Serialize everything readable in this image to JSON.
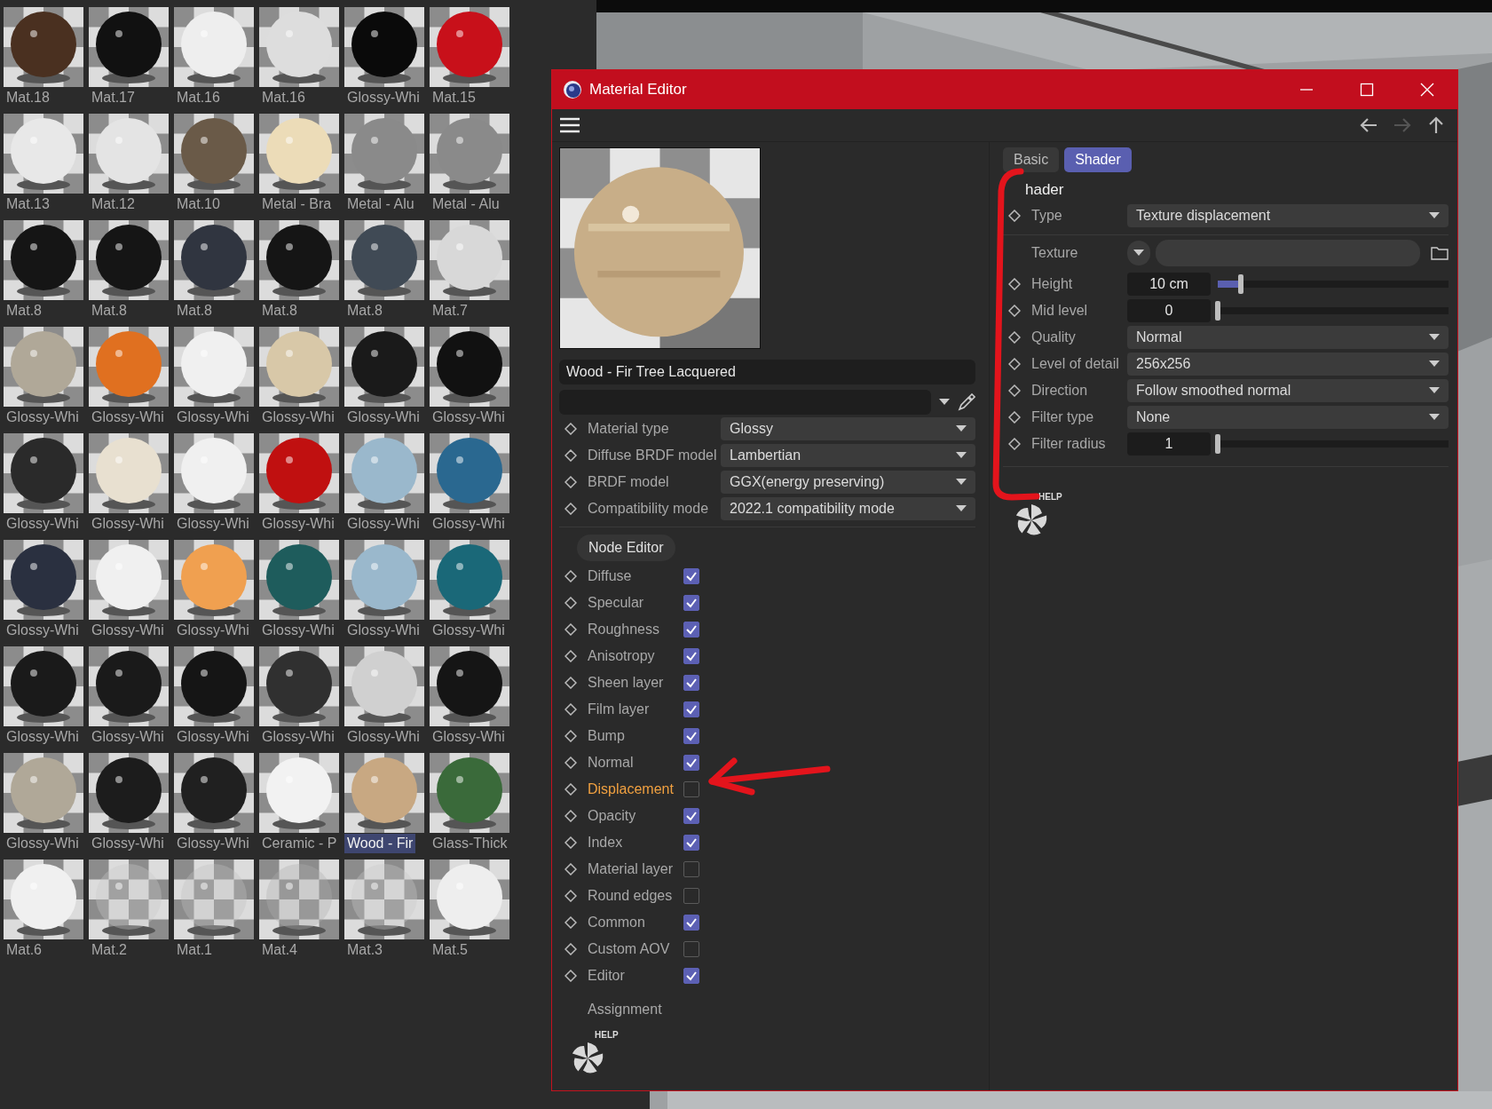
{
  "materials": [
    {
      "name": "Mat.18",
      "selected": false
    },
    {
      "name": "Mat.17",
      "selected": false
    },
    {
      "name": "Mat.16",
      "selected": false
    },
    {
      "name": "Mat.16",
      "selected": false
    },
    {
      "name": "Glossy-Whi",
      "selected": false
    },
    {
      "name": "Mat.15",
      "selected": false
    },
    {
      "name": "Mat.13",
      "selected": false
    },
    {
      "name": "Mat.12",
      "selected": false
    },
    {
      "name": "Mat.10",
      "selected": false
    },
    {
      "name": "Metal - Bra",
      "selected": false
    },
    {
      "name": "Metal - Alu",
      "selected": false
    },
    {
      "name": "Metal - Alu",
      "selected": false
    },
    {
      "name": "Mat.8",
      "selected": false
    },
    {
      "name": "Mat.8",
      "selected": false
    },
    {
      "name": "Mat.8",
      "selected": false
    },
    {
      "name": "Mat.8",
      "selected": false
    },
    {
      "name": "Mat.8",
      "selected": false
    },
    {
      "name": "Mat.7",
      "selected": false
    },
    {
      "name": "Glossy-Whi",
      "selected": false
    },
    {
      "name": "Glossy-Whi",
      "selected": false
    },
    {
      "name": "Glossy-Whi",
      "selected": false
    },
    {
      "name": "Glossy-Whi",
      "selected": false
    },
    {
      "name": "Glossy-Whi",
      "selected": false
    },
    {
      "name": "Glossy-Whi",
      "selected": false
    },
    {
      "name": "Glossy-Whi",
      "selected": false
    },
    {
      "name": "Glossy-Whi",
      "selected": false
    },
    {
      "name": "Glossy-Whi",
      "selected": false
    },
    {
      "name": "Glossy-Whi",
      "selected": false
    },
    {
      "name": "Glossy-Whi",
      "selected": false
    },
    {
      "name": "Glossy-Whi",
      "selected": false
    },
    {
      "name": "Glossy-Whi",
      "selected": false
    },
    {
      "name": "Glossy-Whi",
      "selected": false
    },
    {
      "name": "Glossy-Whi",
      "selected": false
    },
    {
      "name": "Glossy-Whi",
      "selected": false
    },
    {
      "name": "Glossy-Whi",
      "selected": false
    },
    {
      "name": "Glossy-Whi",
      "selected": false
    },
    {
      "name": "Glossy-Whi",
      "selected": false
    },
    {
      "name": "Glossy-Whi",
      "selected": false
    },
    {
      "name": "Glossy-Whi",
      "selected": false
    },
    {
      "name": "Glossy-Whi",
      "selected": false
    },
    {
      "name": "Glossy-Whi",
      "selected": false
    },
    {
      "name": "Glossy-Whi",
      "selected": false
    },
    {
      "name": "Glossy-Whi",
      "selected": false
    },
    {
      "name": "Glossy-Whi",
      "selected": false
    },
    {
      "name": "Glossy-Whi",
      "selected": false
    },
    {
      "name": "Ceramic - P",
      "selected": false
    },
    {
      "name": "Wood - Fir",
      "selected": true
    },
    {
      "name": "Glass-Thick",
      "selected": false
    },
    {
      "name": "Mat.6",
      "selected": false
    },
    {
      "name": "Mat.2",
      "selected": false
    },
    {
      "name": "Mat.1",
      "selected": false
    },
    {
      "name": "Mat.4",
      "selected": false
    },
    {
      "name": "Mat.3",
      "selected": false
    },
    {
      "name": "Mat.5",
      "selected": false
    }
  ],
  "editor": {
    "title": "Material Editor",
    "nav": [
      {
        "kind": "back",
        "disabled": false
      },
      {
        "kind": "forward",
        "disabled": true
      },
      {
        "kind": "up",
        "disabled": false
      }
    ],
    "material_name": "Wood - Fir Tree Lacquered",
    "params": [
      {
        "label": "Material type",
        "value": "Glossy"
      },
      {
        "label": "Diffuse BRDF model",
        "value": "Lambertian"
      },
      {
        "label": "BRDF model",
        "value": "GGX(energy preserving)"
      },
      {
        "label": "Compatibility mode",
        "value": "2022.1 compatibility mode"
      }
    ],
    "node_editor": "Node Editor",
    "channels": [
      {
        "label": "Diffuse",
        "checked": true,
        "highlighted": false
      },
      {
        "label": "Specular",
        "checked": true,
        "highlighted": false
      },
      {
        "label": "Roughness",
        "checked": true,
        "highlighted": false
      },
      {
        "label": "Anisotropy",
        "checked": true,
        "highlighted": false
      },
      {
        "label": "Sheen layer",
        "checked": true,
        "highlighted": false
      },
      {
        "label": "Film layer",
        "checked": true,
        "highlighted": false
      },
      {
        "label": "Bump",
        "checked": true,
        "highlighted": false
      },
      {
        "label": "Normal",
        "checked": true,
        "highlighted": false
      },
      {
        "label": "Displacement",
        "checked": false,
        "highlighted": true
      },
      {
        "label": "Opacity",
        "checked": true,
        "highlighted": false
      },
      {
        "label": "Index",
        "checked": true,
        "highlighted": false
      },
      {
        "label": "Material layer",
        "checked": false,
        "highlighted": false
      },
      {
        "label": "Round edges",
        "checked": false,
        "highlighted": false
      },
      {
        "label": "Common",
        "checked": true,
        "highlighted": false
      },
      {
        "label": "Custom AOV",
        "checked": false,
        "highlighted": false
      },
      {
        "label": "Editor",
        "checked": true,
        "highlighted": false
      }
    ],
    "assignment": "Assignment",
    "help": "HELP",
    "tabs": [
      {
        "label": "Basic",
        "selected": false
      },
      {
        "label": "Shader",
        "selected": true
      }
    ],
    "section_title": "hader",
    "shader_rows": [
      {
        "kind": "dropdown",
        "label": "Type",
        "value": "Texture displacement"
      },
      {
        "kind": "texture",
        "label": "Texture"
      },
      {
        "kind": "slider",
        "label": "Height",
        "value": "10 cm",
        "level": 0.1
      },
      {
        "kind": "slider",
        "label": "Mid level",
        "value": "0",
        "level": 0
      },
      {
        "kind": "dropdown",
        "label": "Quality",
        "value": "Normal"
      },
      {
        "kind": "dropdown",
        "label": "Level of detail",
        "value": "256x256"
      },
      {
        "kind": "dropdown",
        "label": "Direction",
        "value": "Follow smoothed normal"
      },
      {
        "kind": "dropdown",
        "label": "Filter type",
        "value": "None"
      },
      {
        "kind": "slider",
        "label": "Filter radius",
        "value": "1",
        "level": 0
      }
    ],
    "shader_help": "HELP"
  }
}
